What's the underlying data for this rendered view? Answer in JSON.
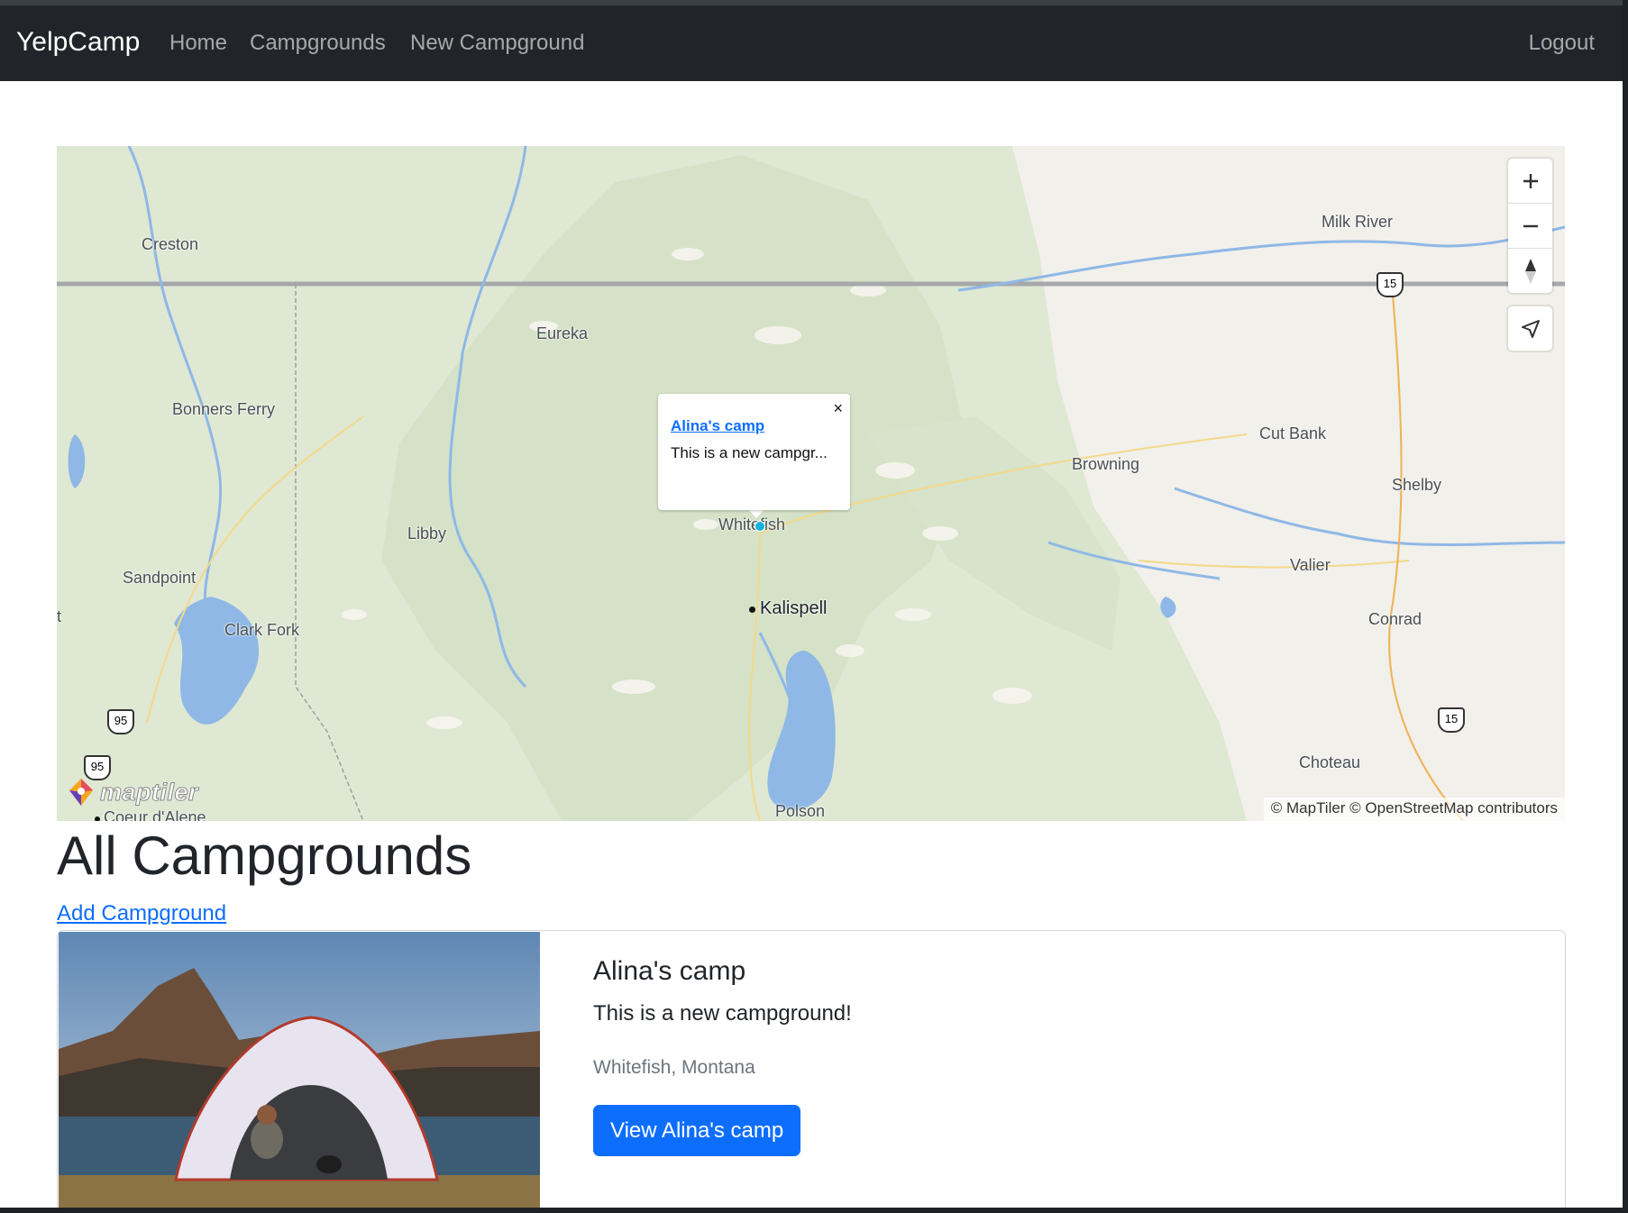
{
  "navbar": {
    "brand": "YelpCamp",
    "links": [
      "Home",
      "Campgrounds",
      "New Campground"
    ],
    "logout": "Logout"
  },
  "map": {
    "places": [
      "Creston",
      "Eureka",
      "Bonners Ferry",
      "Libby",
      "Sandpoint",
      "Clark Fork",
      "Whitefish",
      "Kalispell",
      "Polson",
      "Coeur d'Alene",
      "Milk River",
      "Cut Bank",
      "Browning",
      "Shelby",
      "Valier",
      "Conrad",
      "Choteau",
      "t"
    ],
    "shields": [
      "95",
      "95",
      "15",
      "15"
    ],
    "popup": {
      "close": "×",
      "title": "Alina's camp",
      "description": "This is a new campgr..."
    },
    "logo_text": "maptiler",
    "attribution": "© MapTiler © OpenStreetMap contributors",
    "controls": [
      "zoom-in",
      "zoom-out",
      "compass",
      "geolocate"
    ]
  },
  "page": {
    "title": "All Campgrounds",
    "add_link": "Add Campground"
  },
  "campgrounds": [
    {
      "title": "Alina's camp",
      "description": "This is a new campground!",
      "location": "Whitefish, Montana",
      "button": "View Alina's camp"
    }
  ]
}
